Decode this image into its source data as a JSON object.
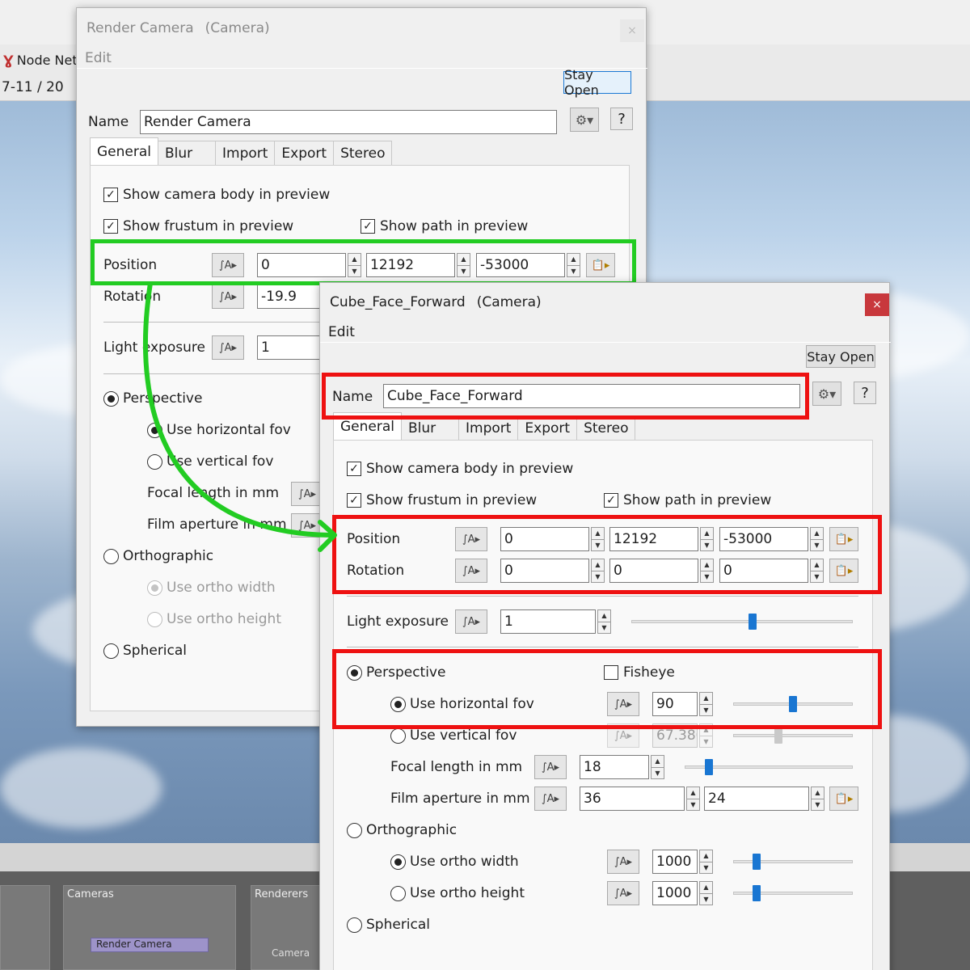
{
  "colors": {
    "highlight_green": "#22cc22",
    "highlight_red": "#ee1111",
    "close_red": "#c8383c",
    "slider_blue": "#1976d2"
  },
  "background": {
    "node_tab_label": "Node Net",
    "frame_label": "7-11 / 20",
    "node_panels": {
      "cameras": "Cameras",
      "renderers": "Renderers",
      "render_camera_node": "Render Camera",
      "camera_node": "Camera"
    }
  },
  "window1": {
    "title": "Render Camera",
    "subtitle": "(Camera)",
    "menu_edit": "Edit",
    "stay_open": "Stay Open",
    "name_label": "Name",
    "name_value": "Render Camera",
    "help": "?",
    "tabs": [
      "General",
      "Blur",
      "Import",
      "Export",
      "Stereo"
    ],
    "show_body": "Show camera body in preview",
    "show_frustum": "Show frustum in preview",
    "show_path": "Show path in preview",
    "position_label": "Position",
    "position": [
      "0",
      "12192",
      "-53000"
    ],
    "rotation_label": "Rotation",
    "rotation_x": "-19.9",
    "light_label": "Light exposure",
    "light_value": "1",
    "perspective": "Perspective",
    "horiz_fov": "Use horizontal fov",
    "vert_fov": "Use vertical fov",
    "focal": "Focal length in mm",
    "film": "Film aperture in mm",
    "ortho": "Orthographic",
    "ortho_w": "Use ortho width",
    "ortho_h": "Use ortho height",
    "spherical": "Spherical"
  },
  "window2": {
    "title": "Cube_Face_Forward",
    "subtitle": "(Camera)",
    "menu_edit": "Edit",
    "stay_open": "Stay Open",
    "close": "×",
    "name_label": "Name",
    "name_value": "Cube_Face_Forward",
    "help": "?",
    "tabs": [
      "General",
      "Blur",
      "Import",
      "Export",
      "Stereo"
    ],
    "show_body": "Show camera body in preview",
    "show_frustum": "Show frustum in preview",
    "show_path": "Show path in preview",
    "position_label": "Position",
    "position": [
      "0",
      "12192",
      "-53000"
    ],
    "rotation_label": "Rotation",
    "rotation": [
      "0",
      "0",
      "0"
    ],
    "light_label": "Light exposure",
    "light_value": "1",
    "light_slider": 0.55,
    "perspective": "Perspective",
    "fisheye": "Fisheye",
    "horiz_fov": "Use horizontal fov",
    "horiz_fov_value": "90",
    "horiz_fov_slider": 0.5,
    "vert_fov": "Use vertical fov",
    "vert_fov_value": "67.380",
    "focal": "Focal length in mm",
    "focal_value": "18",
    "film": "Film aperture in mm",
    "film_values": [
      "36",
      "24"
    ],
    "ortho": "Orthographic",
    "ortho_w": "Use ortho width",
    "ortho_w_value": "1000",
    "ortho_h": "Use ortho height",
    "ortho_h_value": "1000",
    "spherical": "Spherical"
  }
}
